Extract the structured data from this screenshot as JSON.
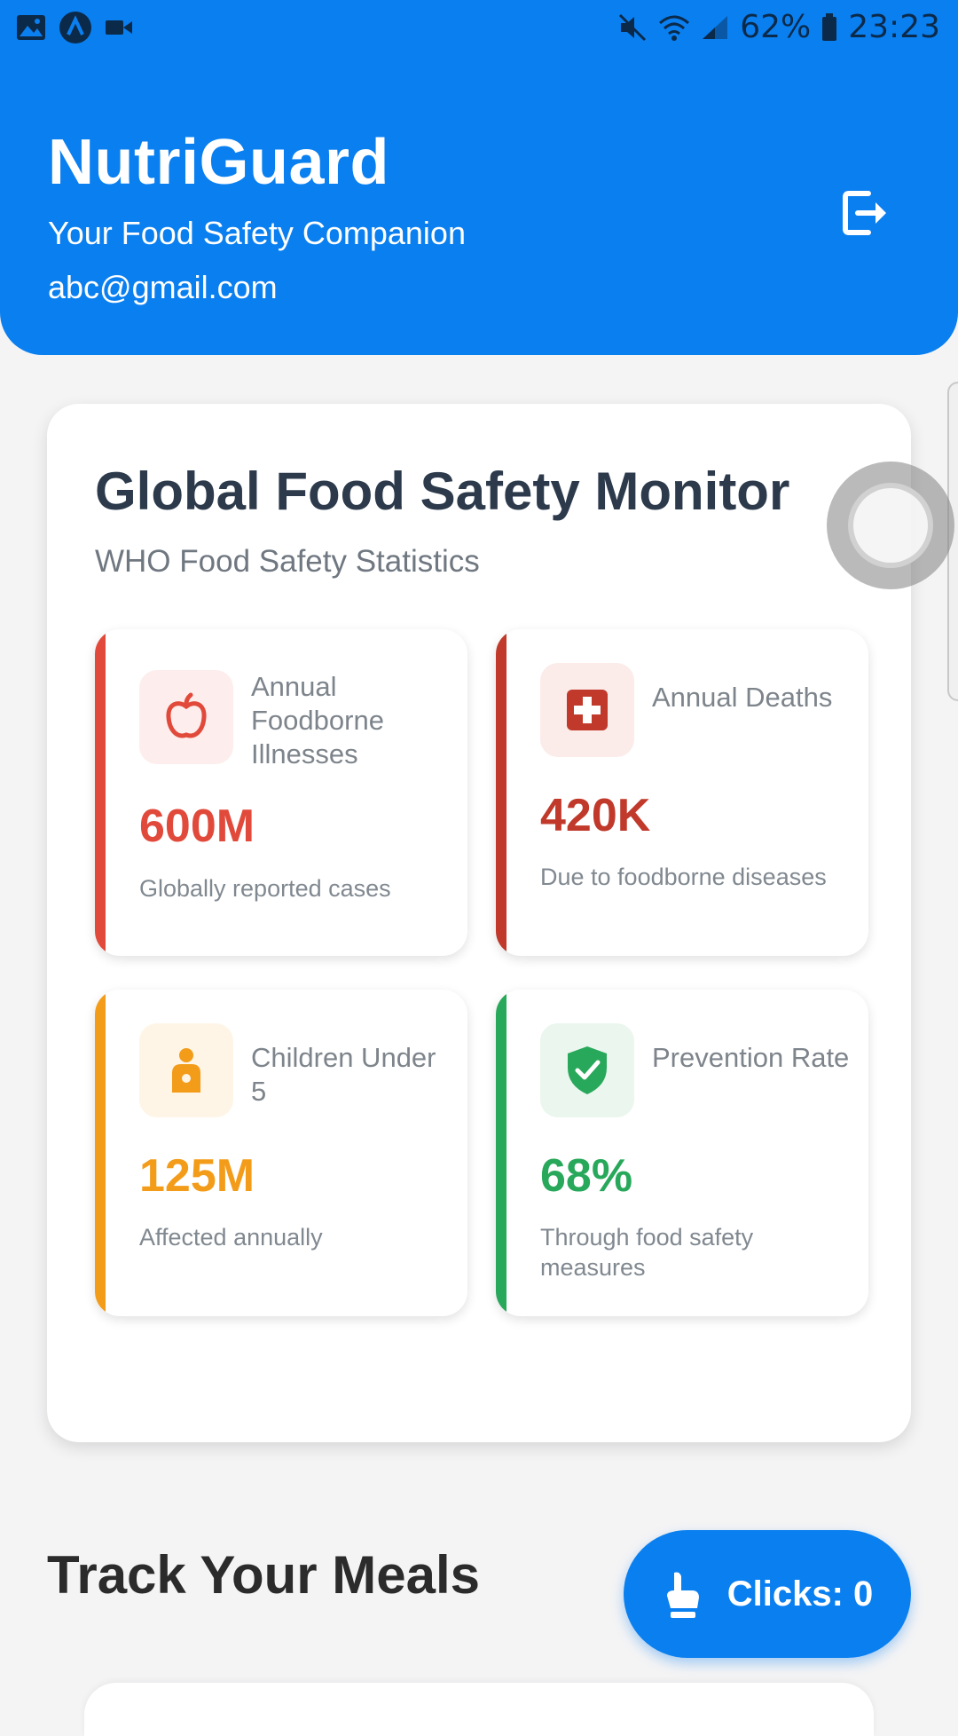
{
  "status_bar": {
    "battery": "62%",
    "time": "23:23"
  },
  "header": {
    "title": "NutriGuard",
    "subtitle": "Your Food Safety Companion",
    "email": "abc@gmail.com"
  },
  "monitor": {
    "title": "Global Food Safety Monitor",
    "subtitle": "WHO Food Safety Statistics",
    "stats": [
      {
        "label": "Annual Foodborne Illnesses",
        "value": "600M",
        "desc": "Globally reported cases",
        "color": "#e14a3b",
        "icon": "apple-icon"
      },
      {
        "label": "Annual Deaths",
        "value": "420K",
        "desc": "Due to foodborne diseases",
        "color": "#c0392b",
        "icon": "medical-cross-icon"
      },
      {
        "label": "Children Under 5",
        "value": "125M",
        "desc": "Affected annually",
        "color": "#f39c1a",
        "icon": "child-icon"
      },
      {
        "label": "Prevention Rate",
        "value": "68%",
        "desc": "Through food safety measures",
        "color": "#28a85a",
        "icon": "shield-check-icon"
      }
    ]
  },
  "track": {
    "title": "Track Your Meals"
  },
  "clicks_button": {
    "label": "Clicks: 0"
  },
  "colors": {
    "primary": "#0a7ff0",
    "red": "#e14a3b",
    "dark_red": "#c0392b",
    "orange": "#f39c1a",
    "green": "#28a85a"
  }
}
